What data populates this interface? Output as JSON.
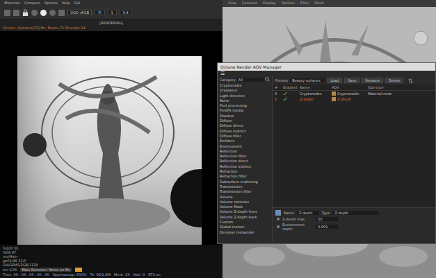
{
  "render_window": {
    "menu": [
      "Materials",
      "Compare",
      "Options",
      "Help",
      "GUI"
    ],
    "toolbar": {
      "dropdown": "OOO-sRGB",
      "fields": [
        "FI",
        "1",
        "0.4"
      ]
    },
    "title": "[RENDERING]",
    "info_line": "Octane: Updated[32] Ms: Nodes:71 Movable:14"
  },
  "status": {
    "lines": [
      "%100  50",
      "%08  97",
      "ms/Main",
      "gb02/48 21/0",
      "GH/GEMS/2GB/1128"
    ],
    "denoiser": "Main Denoiser: Noise on Ms",
    "bottom": [
      "ms:1/36",
      "Time: 00 : 00 : 05 : 00 . 00",
      "Spp/maxspp: 50/50",
      "Tri: 96/1.8M",
      "Mesh: 20",
      "Hair: 0",
      "RTX:on"
    ]
  },
  "viewport": {
    "menu": [
      "View",
      "Cameras",
      "Display",
      "Options",
      "Filter",
      "Panel"
    ]
  },
  "aov_manager": {
    "title": "Octane Render AOV Manager",
    "menu_icon": "☰",
    "category_label": "Category",
    "category_value": "All",
    "categories": [
      "Cryptomatte",
      "Irradiance",
      "Light direction",
      "Noise",
      "Post processing",
      "PostFX media",
      "Shadow",
      "Diffuse",
      "Diffuse direct",
      "Diffuse indirect",
      "Diffuse filter",
      "Emitters",
      "Environment",
      "Reflection",
      "Reflection filter",
      "Reflection direct",
      "Reflection indirect",
      "Refraction",
      "Refraction filter",
      "Subsurface scattering",
      "Transmission",
      "Transmission filter",
      "Volume",
      "Volume emission",
      "Volume Mask",
      "Volume Z-depth front",
      "Volume Z-depth back",
      "Custom",
      "Global texture",
      "Denoiser remainder"
    ],
    "presets_label": "Presets",
    "preset_value": "Beauty surfaces",
    "buttons": [
      "Load",
      "Save",
      "Rename",
      "Delete"
    ],
    "columns": [
      "#",
      "Enabled",
      "Name",
      "AOV",
      "Sub-type"
    ],
    "rows": [
      {
        "index": "0",
        "enabled": true,
        "name": "Cryptomatte",
        "aov": "Cryptomatte",
        "subtype": "Material node",
        "selected": false
      },
      {
        "index": "1",
        "enabled": true,
        "name": "Z-depth",
        "aov": "Z-depth",
        "subtype": "",
        "selected": true
      }
    ],
    "properties": {
      "checked": true,
      "name_label": "Name",
      "name_value": "Z-depth",
      "type_label": "Type",
      "type_value": "Z-depth",
      "params": [
        {
          "label": "Z-depth max",
          "value": "50"
        },
        {
          "label": "Environment depth",
          "value": "0.001"
        }
      ]
    }
  }
}
